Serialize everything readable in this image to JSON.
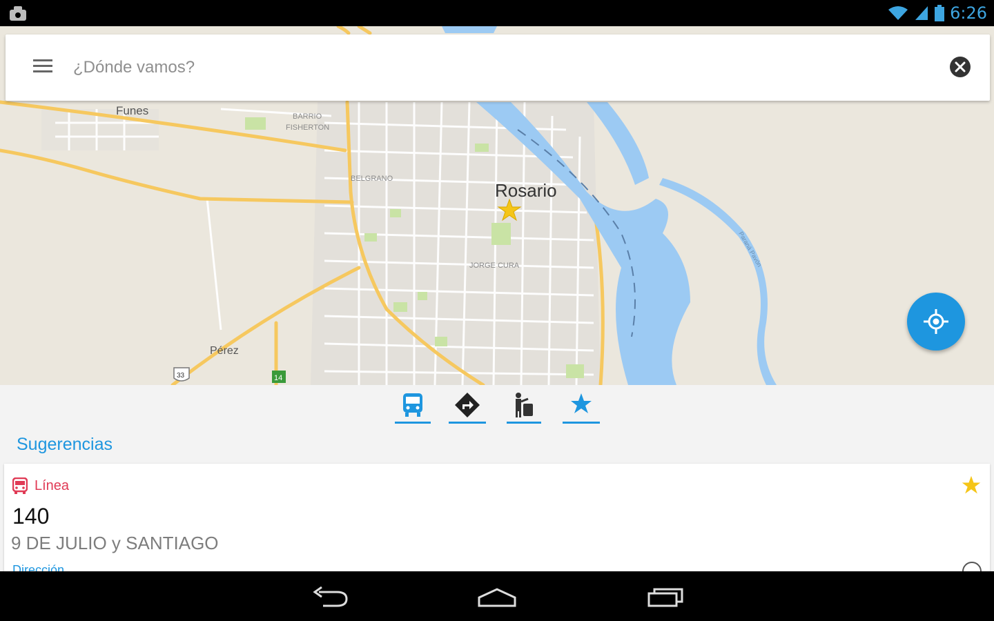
{
  "status_bar": {
    "time": "6:26"
  },
  "search": {
    "placeholder": "¿Dónde vamos?",
    "value": ""
  },
  "map": {
    "labels": {
      "funes": "Funes",
      "barrio1": "BARRIO",
      "barrio2": "FISHERTON",
      "belgrano": "BELGRANO",
      "rosario": "Rosario",
      "jorge_cura": "JORGE CURA",
      "perez": "Pérez",
      "route_33": "33",
      "route_14": "14",
      "river_label": "Paraná Pavón"
    }
  },
  "tabs": [
    {
      "name": "bus"
    },
    {
      "name": "directions"
    },
    {
      "name": "stops"
    },
    {
      "name": "favorites"
    }
  ],
  "suggestions": {
    "title": "Sugerencias",
    "card": {
      "type_label": "Línea",
      "number": "140",
      "address": "9 DE JULIO y SANTIAGO",
      "extra": "Dirección"
    }
  },
  "colors": {
    "accent": "#1e96df",
    "bus_red": "#e03a55",
    "star": "#f5c518",
    "road": "#f6c85f",
    "water": "#9ccaf3"
  }
}
